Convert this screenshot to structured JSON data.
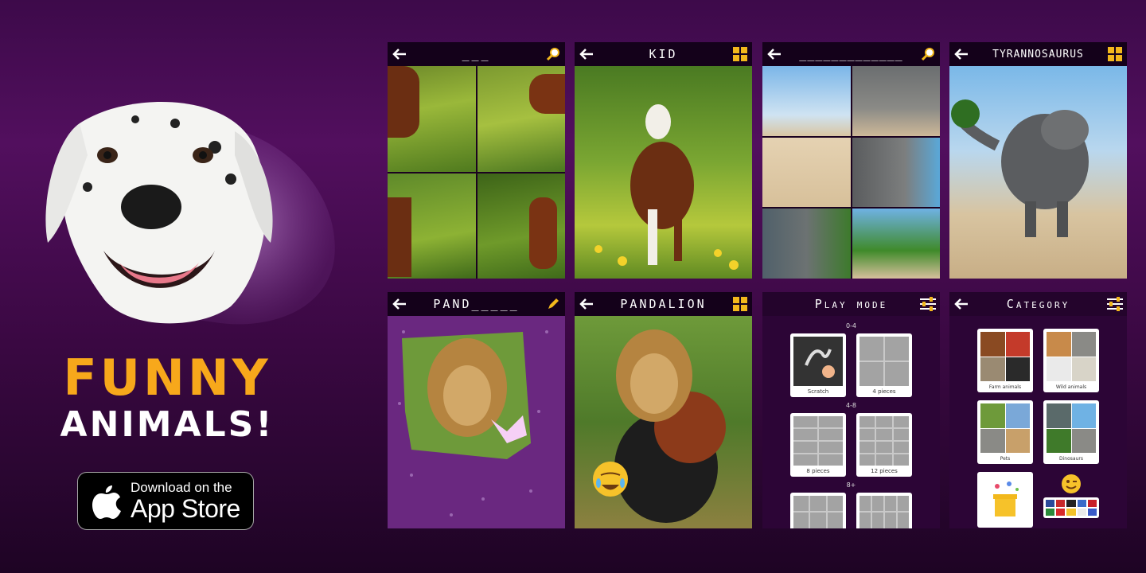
{
  "promo": {
    "headline_line1": "FUNNY",
    "headline_line2": "ANIMALS!",
    "badge_small": "Download on the",
    "badge_big": "App Store",
    "accent_color": "#f7a81b"
  },
  "screens": [
    {
      "title": "___",
      "right_icon": "magnifier-icon"
    },
    {
      "title": "KID",
      "right_icon": "grid-icon"
    },
    {
      "title": "_____________",
      "right_icon": "magnifier-icon"
    },
    {
      "title": "TYRANNOSAURUS",
      "right_icon": "grid-icon"
    },
    {
      "title": "PAND_____",
      "right_icon": "pencil-icon"
    },
    {
      "title": "PANDALION",
      "right_icon": "grid-icon"
    }
  ],
  "play_mode": {
    "title": "Play mode",
    "groups": [
      "0-4",
      "4-8",
      "8+"
    ],
    "cards": [
      "Scratch",
      "4 pieces",
      "8 pieces",
      "12 pieces"
    ]
  },
  "category": {
    "title": "Category",
    "cards": [
      "Farm animals",
      "Wild animals",
      "Pets",
      "Dinosaurs"
    ]
  }
}
